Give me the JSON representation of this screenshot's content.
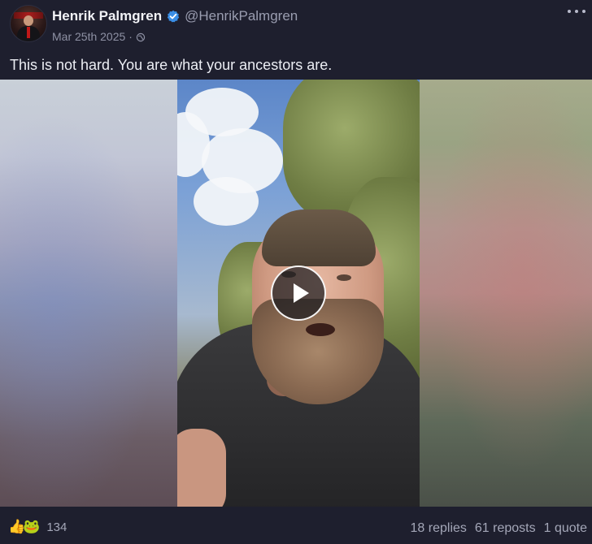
{
  "author": {
    "display_name": "Henrik Palmgren",
    "handle": "@HenrikPalmgren",
    "verified": true
  },
  "meta": {
    "date": "Mar 25th 2025",
    "separator": "·",
    "visibility_icon": "globe-icon"
  },
  "post": {
    "text": "This is not hard. You are what your ancestors are."
  },
  "media": {
    "type": "video",
    "play_icon": "play-icon"
  },
  "reactions": {
    "emojis": [
      "👍",
      "🐸"
    ],
    "count": "134"
  },
  "stats": {
    "replies": "18 replies",
    "reposts": "61 reposts",
    "quotes": "1 quote"
  },
  "colors": {
    "background": "#1e1f2e",
    "verified_badge": "#3a8ee6",
    "text_primary": "#eceef4",
    "text_muted": "#9a9db0"
  }
}
